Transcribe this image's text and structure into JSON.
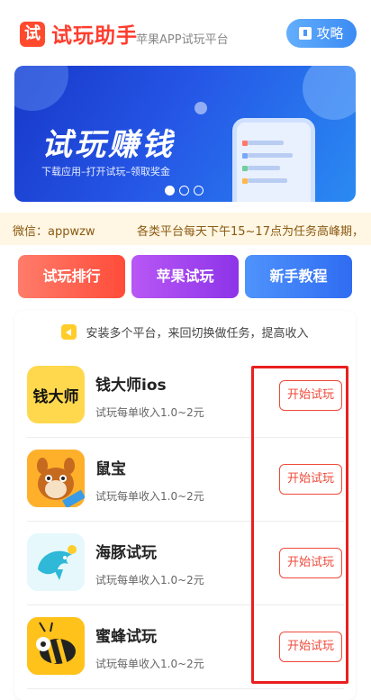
{
  "header": {
    "logo_char": "试",
    "logo_text": "试玩助手",
    "subtitle": "苹果APP试玩平台",
    "guide_label": "攻略"
  },
  "banner": {
    "title": "试玩赚钱",
    "desc": "下载应用–打开试玩–领取奖金",
    "slides_total": 3,
    "active_slide": 1
  },
  "notice": {
    "text_left": "微信：appwzw",
    "text_right": "各类平台每天下午15~17点为任务高峰期，"
  },
  "actions": {
    "rank": "试玩排行",
    "apple": "苹果试玩",
    "tutorial": "新手教程"
  },
  "tip": "安装多个平台，来回切换做任务，提高收入",
  "apps": [
    {
      "name": "钱大师ios",
      "desc": "试玩每单收入1.0~2元",
      "button": "开始试玩",
      "icon_text": "钱大师",
      "icon_color": "#ffd84d"
    },
    {
      "name": "鼠宝",
      "desc": "试玩每单收入1.0~2元",
      "button": "开始试玩",
      "icon_color": "#ffb02b"
    },
    {
      "name": "海豚试玩",
      "desc": "试玩每单收入1.0~2元",
      "button": "开始试玩",
      "icon_color": "#e6f8fb"
    },
    {
      "name": "蜜蜂试玩",
      "desc": "试玩每单收入1.0~2元",
      "button": "开始试玩",
      "icon_color": "#ffc21a"
    }
  ],
  "colors": {
    "brand": "#ff3d2e",
    "guide": "#3b8bf4",
    "highlight_box": "#ea1f1f"
  }
}
